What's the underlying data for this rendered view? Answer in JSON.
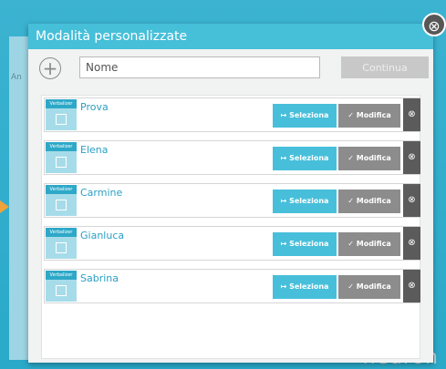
{
  "background": {
    "side_label": "An",
    "logo_text": "neuron"
  },
  "modal": {
    "title": "Modalità personalizzate",
    "close_glyph": "⊗",
    "add_glyph": "+",
    "name_input": {
      "value": "",
      "placeholder": "Nome"
    },
    "continue_label": "Continua",
    "rows": [
      {
        "name": "Prova",
        "badge": "Verbalizer"
      },
      {
        "name": "Elena",
        "badge": "Verbalizer"
      },
      {
        "name": "Carmine",
        "badge": "Verbalizer"
      },
      {
        "name": "Gianluca",
        "badge": "Verbalizer"
      },
      {
        "name": "Sabrina",
        "badge": "Verbalizer"
      }
    ],
    "select_label": "↦ Seleziona",
    "edit_label": "✓ Modifica",
    "delete_glyph": "⊗"
  },
  "colors": {
    "accent": "#46bfd9",
    "edit_gray": "#8c8c8c",
    "delete_dark": "#5b5b5b",
    "page_bg": "#2aa9c9"
  }
}
